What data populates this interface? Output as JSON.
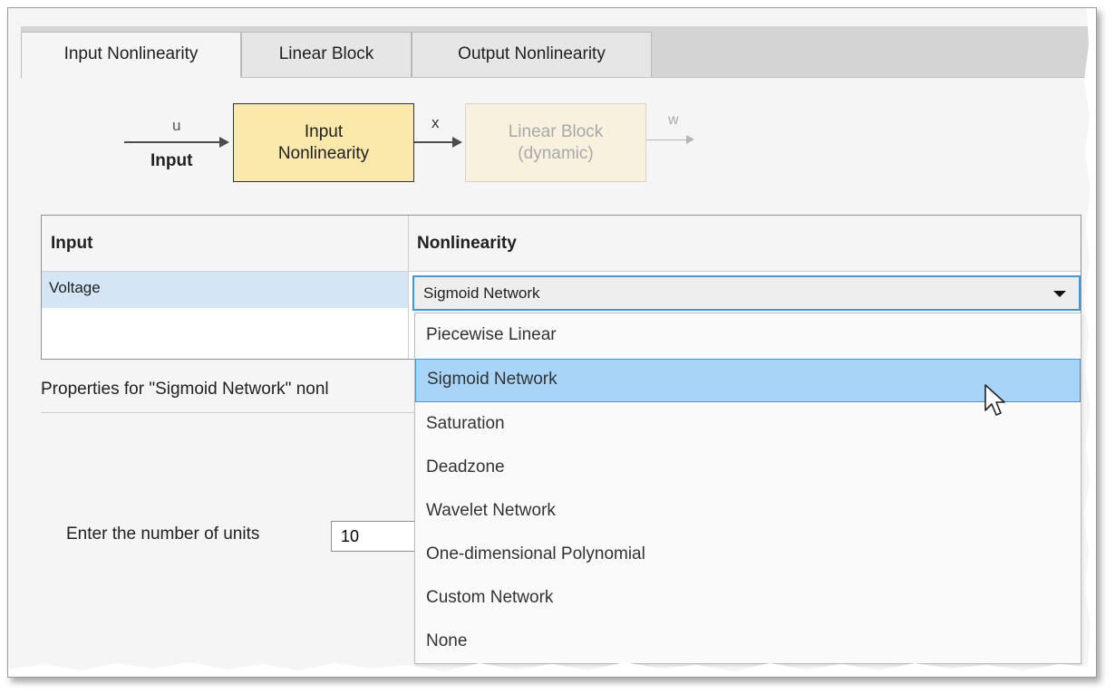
{
  "tabs": [
    {
      "label": "Input Nonlinearity",
      "active": true
    },
    {
      "label": "Linear Block",
      "active": false
    },
    {
      "label": "Output Nonlinearity",
      "active": false
    }
  ],
  "diagram": {
    "input_signal": "u",
    "input_label": "Input",
    "block1": [
      "Input",
      "Nonlinearity"
    ],
    "mid_signal": "x",
    "block2": [
      "Linear Block",
      "(dynamic)"
    ],
    "output_signal": "w"
  },
  "table": {
    "headers": [
      "Input",
      "Nonlinearity"
    ],
    "rows": [
      {
        "input": "Voltage",
        "nonlinearity": "Sigmoid Network"
      }
    ]
  },
  "dropdown": {
    "options": [
      "Piecewise Linear",
      "Sigmoid Network",
      "Saturation",
      "Deadzone",
      "Wavelet Network",
      "One-dimensional Polynomial",
      "Custom Network",
      "None"
    ],
    "highlighted": "Sigmoid Network"
  },
  "properties_label": "Properties for \"Sigmoid Network\" nonl",
  "units": {
    "label": "Enter the number of units",
    "value": "10"
  },
  "icons": {
    "dropdown": "chevron-down-icon",
    "cursor": "mouse-pointer-icon",
    "scroll": "scroll-down-arrow-icon"
  },
  "colors": {
    "active_block": "#fbe8ab",
    "selection": "#a8d4f7",
    "focus_border": "#3b9ae3",
    "row_highlight": "#d4e6f5"
  }
}
